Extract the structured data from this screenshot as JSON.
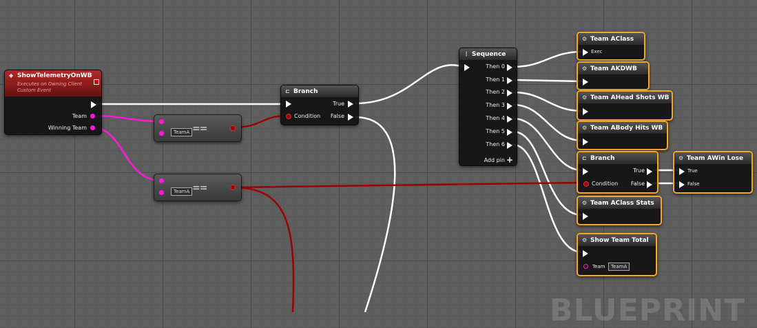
{
  "event_node": {
    "title": "ShowTelemetryOnWB",
    "subtitle": "Executes on Owning Client",
    "subtitle2": "Custom Event",
    "team_label": "Team",
    "winning_team_label": "Winning Team"
  },
  "eq_nodes": [
    {
      "symbol": "==",
      "value": "TeamA"
    },
    {
      "symbol": "==",
      "value": "TeamA"
    }
  ],
  "branch1": {
    "title": "Branch",
    "true_label": "True",
    "false_label": "False",
    "condition_label": "Condition"
  },
  "sequence": {
    "title": "Sequence",
    "outputs": [
      "Then 0",
      "Then 1",
      "Then 2",
      "Then 3",
      "Then 4",
      "Then 5",
      "Then 6"
    ],
    "add_pin_label": "Add pin"
  },
  "func_nodes": {
    "aclass": {
      "title": "Team AClass",
      "exec_label": "Exec"
    },
    "akdwb": {
      "title": "Team AKDWB"
    },
    "ahead": {
      "title": "Team AHead Shots WB"
    },
    "abody": {
      "title": "Team ABody Hits WB"
    },
    "aclassstats": {
      "title": "Team AClass Stats"
    },
    "showtotal": {
      "title": "Show Team Total",
      "team_label": "Team",
      "team_value": "TeamA"
    },
    "awinlose": {
      "title": "Team AWin Lose",
      "true_label": "True",
      "false_label": "False"
    }
  },
  "branch2": {
    "title": "Branch",
    "true_label": "True",
    "false_label": "False",
    "condition_label": "Condition"
  },
  "watermark": "BLUEPRINT",
  "colors": {
    "exec_wire": "#ffffff",
    "bool_wire": "#9a0000",
    "enum_wire": "#ff1bd6",
    "selected": "#f5a623"
  }
}
